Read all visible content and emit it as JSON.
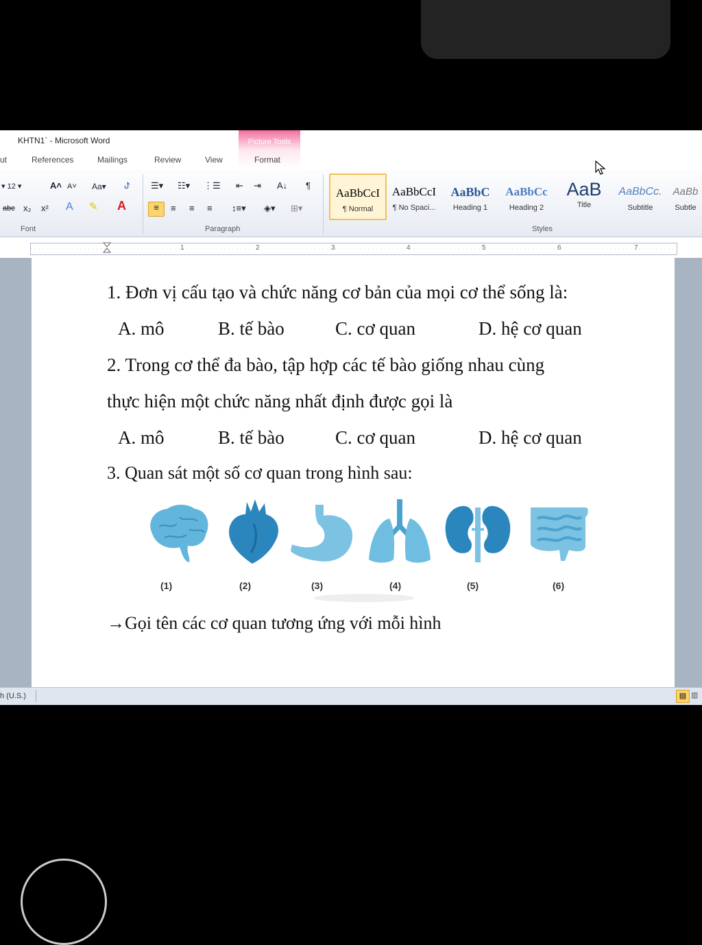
{
  "window": {
    "title": "KHTN1` - Microsoft Word",
    "contextual_tab": "Picture Tools"
  },
  "tabs": [
    "ut",
    "References",
    "Mailings",
    "Review",
    "View",
    "Format"
  ],
  "ribbon": {
    "font_size": "12",
    "groups": {
      "font": "Font",
      "paragraph": "Paragraph",
      "styles": "Styles"
    },
    "styles": [
      {
        "sample": "AaBbCcI",
        "name": "¶ Normal"
      },
      {
        "sample": "AaBbCcI",
        "name": "¶ No Spaci..."
      },
      {
        "sample": "AaBbC",
        "name": "Heading 1"
      },
      {
        "sample": "AaBbCc",
        "name": "Heading 2"
      },
      {
        "sample": "AaB",
        "name": "Title"
      },
      {
        "sample": "AaBbCc.",
        "name": "Subtitle"
      },
      {
        "sample": "AaBb",
        "name": "Subtle"
      }
    ]
  },
  "ruler": {
    "numbers": [
      "1",
      "2",
      "3",
      "4",
      "5",
      "6",
      "7"
    ]
  },
  "document": {
    "q1": "1. Đơn vị cấu tạo và chức năng cơ bản của mọi cơ thể sống là:",
    "q1_options": [
      "A. mô",
      "B. tế bào",
      "C. cơ quan",
      "D. hệ cơ quan"
    ],
    "q2_line1": "2. Trong cơ thể đa bào, tập hợp các tế bào giống nhau cùng",
    "q2_line2": "thực hiện một chức năng nhất định được gọi là",
    "q2_options": [
      "A. mô",
      "B. tế bào",
      "C. cơ quan",
      "D. hệ cơ quan"
    ],
    "q3": "3. Quan sát một số cơ quan trong hình sau:",
    "organ_labels": [
      "(1)",
      "(2)",
      "(3)",
      "(4)",
      "(5)",
      "(6)"
    ],
    "instruction": "→Gọi tên các cơ quan tương ứng với mỗi hình"
  },
  "status": {
    "language": "h (U.S.)"
  },
  "colors": {
    "organ": "#4aa3cf",
    "picture_tools": "#f26fa0",
    "doc_bg": "#a9b4c2"
  }
}
